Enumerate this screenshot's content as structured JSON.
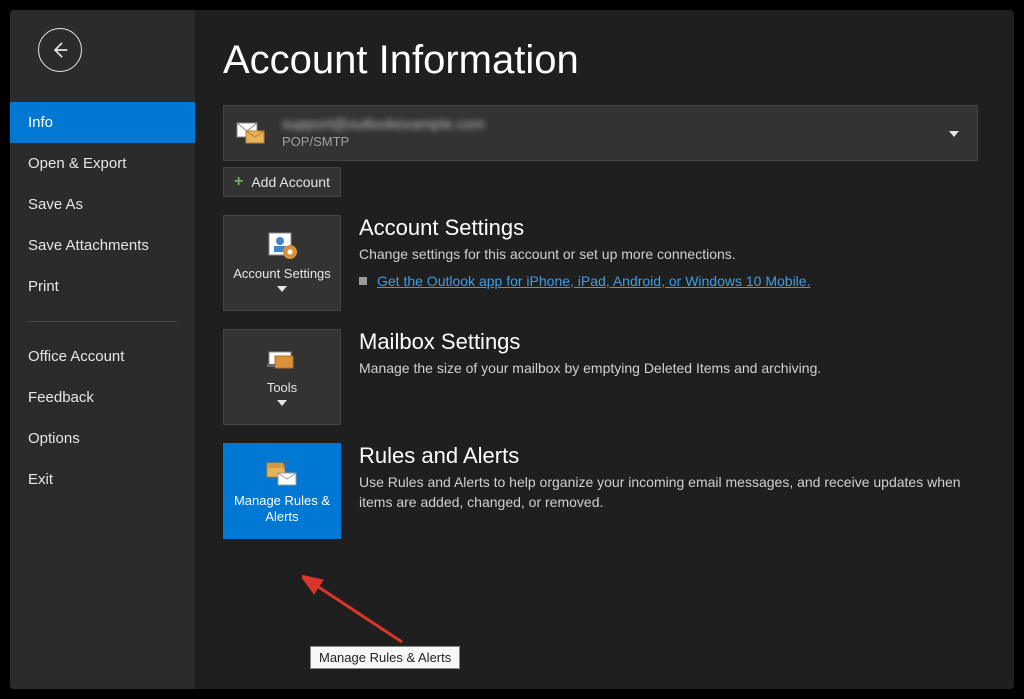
{
  "sidebar": {
    "items": [
      {
        "label": "Info"
      },
      {
        "label": "Open & Export"
      },
      {
        "label": "Save As"
      },
      {
        "label": "Save Attachments"
      },
      {
        "label": "Print"
      },
      {
        "label": "Office Account"
      },
      {
        "label": "Feedback"
      },
      {
        "label": "Options"
      },
      {
        "label": "Exit"
      }
    ]
  },
  "page": {
    "title": "Account Information"
  },
  "account": {
    "email_redacted": "support@outlookexample.com",
    "type": "POP/SMTP"
  },
  "add_account_label": "Add Account",
  "sections": {
    "account_settings": {
      "tile_label": "Account Settings",
      "title": "Account Settings",
      "desc": "Change settings for this account or set up more connections.",
      "link": "Get the Outlook app for iPhone, iPad, Android, or Windows 10 Mobile."
    },
    "mailbox_settings": {
      "tile_label": "Tools",
      "title": "Mailbox Settings",
      "desc": "Manage the size of your mailbox by emptying Deleted Items and archiving."
    },
    "rules_alerts": {
      "tile_label": "Manage Rules & Alerts",
      "title": "Rules and Alerts",
      "desc": "Use Rules and Alerts to help organize your incoming email messages, and receive updates when items are added, changed, or removed."
    }
  },
  "tooltip": "Manage Rules & Alerts"
}
